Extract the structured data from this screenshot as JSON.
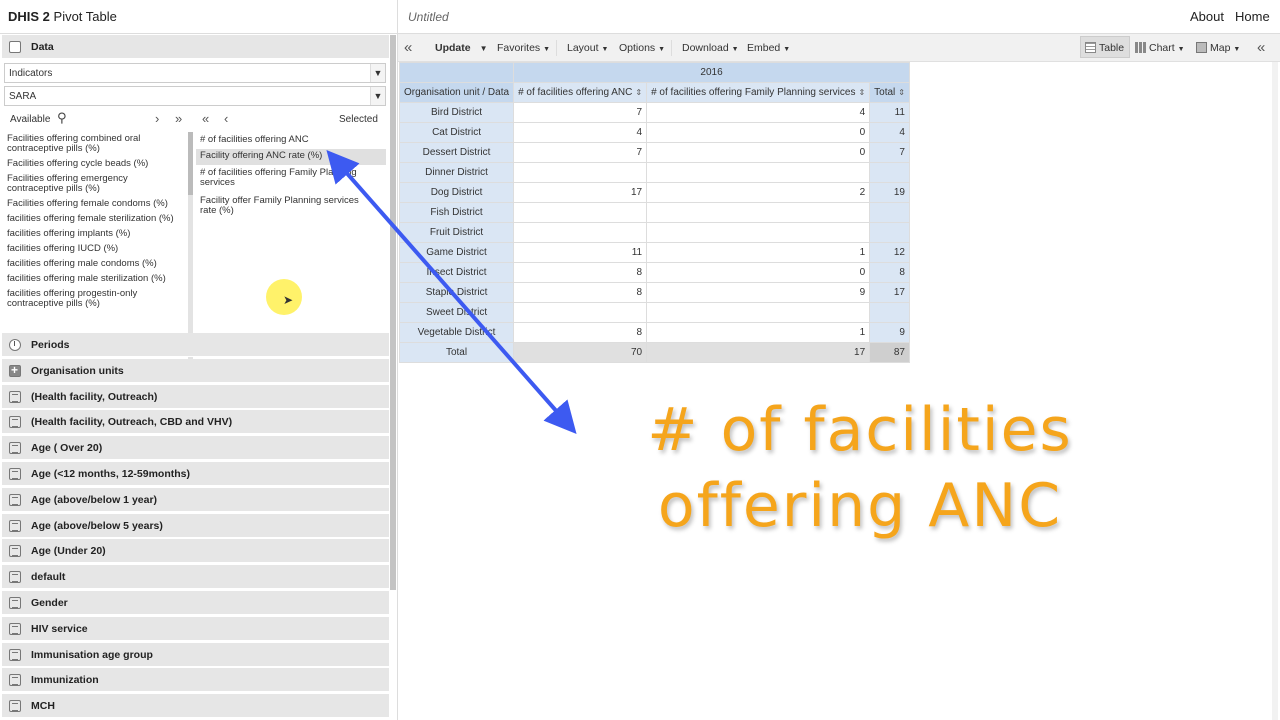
{
  "header": {
    "app_bold": "DHIS 2",
    "app_rest": " Pivot Table",
    "favorite_name": "Untitled",
    "links": [
      "About",
      "Home"
    ]
  },
  "left_panel": {
    "data_section": "Data",
    "group_type": "Indicators",
    "group": "SARA",
    "available_label": "Available",
    "selected_label": "Selected",
    "available_items": [
      "Facilities offering combined oral contraceptive pills (%)",
      "Facilities offering cycle beads (%)",
      "Facilities offering emergency contraceptive pills (%)",
      "Facilities offering female condoms (%)",
      "facilities offering female sterilization (%)",
      "facilities offering implants (%)",
      "facilities offering IUCD (%)",
      "facilities offering male condoms (%)",
      "facilities offering male sterilization (%)",
      "facilities offering progestin-only contraceptive pills (%)"
    ],
    "selected_items": [
      "# of facilities offering ANC",
      "Facility offering ANC rate (%)",
      "# of facilities offering Family Planning services",
      "Facility offer Family Planning services rate (%)"
    ],
    "sections": [
      {
        "label": "Periods",
        "icon": "clock-icon"
      },
      {
        "label": "Organisation units",
        "icon": "plus-icon"
      },
      {
        "label": "(Health facility, Outreach)",
        "icon": "grid-icon"
      },
      {
        "label": "(Health facility, Outreach, CBD and VHV)",
        "icon": "grid-icon"
      },
      {
        "label": "Age ( Over 20)",
        "icon": "grid-icon"
      },
      {
        "label": "Age (<12 months, 12-59months)",
        "icon": "grid-icon"
      },
      {
        "label": "Age (above/below 1 year)",
        "icon": "grid-icon"
      },
      {
        "label": "Age (above/below 5 years)",
        "icon": "grid-icon"
      },
      {
        "label": "Age (Under 20)",
        "icon": "grid-icon"
      },
      {
        "label": "default",
        "icon": "grid-icon"
      },
      {
        "label": "Gender",
        "icon": "grid-icon"
      },
      {
        "label": "HIV service",
        "icon": "grid-icon"
      },
      {
        "label": "Immunisation age group",
        "icon": "grid-icon"
      },
      {
        "label": "Immunization",
        "icon": "grid-icon"
      },
      {
        "label": "MCH",
        "icon": "grid-icon"
      }
    ]
  },
  "toolbar": {
    "collapse_left": "«",
    "update": "Update",
    "favorites": "Favorites",
    "layout": "Layout",
    "options": "Options",
    "download": "Download",
    "embed": "Embed",
    "table": "Table",
    "chart": "Chart",
    "map": "Map",
    "collapse_right": "«"
  },
  "pivot": {
    "period": "2016",
    "corner": "Organisation unit / Data",
    "columns": [
      "# of facilities offering ANC",
      "# of facilities offering Family Planning services",
      "Total"
    ],
    "rows": [
      {
        "name": "Bird District",
        "anc": "7",
        "fp": "4",
        "total": "11"
      },
      {
        "name": "Cat District",
        "anc": "4",
        "fp": "0",
        "total": "4"
      },
      {
        "name": "Dessert District",
        "anc": "7",
        "fp": "0",
        "total": "7"
      },
      {
        "name": "Dinner District",
        "anc": "",
        "fp": "",
        "total": ""
      },
      {
        "name": "Dog District",
        "anc": "17",
        "fp": "2",
        "total": "19"
      },
      {
        "name": "Fish District",
        "anc": "",
        "fp": "",
        "total": ""
      },
      {
        "name": "Fruit District",
        "anc": "",
        "fp": "",
        "total": ""
      },
      {
        "name": "Game District",
        "anc": "11",
        "fp": "1",
        "total": "12"
      },
      {
        "name": "Insect District",
        "anc": "8",
        "fp": "0",
        "total": "8"
      },
      {
        "name": "Staple District",
        "anc": "8",
        "fp": "9",
        "total": "17"
      },
      {
        "name": "Sweet District",
        "anc": "",
        "fp": "",
        "total": ""
      },
      {
        "name": "Vegetable District",
        "anc": "8",
        "fp": "1",
        "total": "9"
      }
    ],
    "total_label": "Total",
    "totals": {
      "anc": "70",
      "fp": "17",
      "total": "87"
    }
  },
  "overlay": {
    "line1": "# of facilities",
    "line2": "offering ANC",
    "color": "#f5a51c",
    "arrow_color": "#3d5af1"
  }
}
